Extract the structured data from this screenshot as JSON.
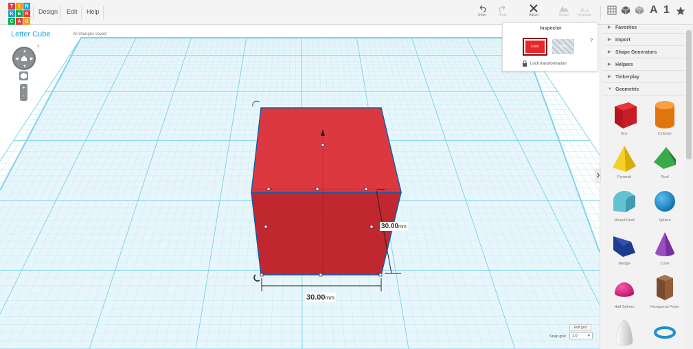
{
  "app": {
    "logo_letters": [
      "TIN",
      "KER",
      "CAD"
    ],
    "menu": [
      {
        "id": "design",
        "label": "Design"
      },
      {
        "id": "edit",
        "label": "Edit"
      },
      {
        "id": "help",
        "label": "Help"
      }
    ]
  },
  "toolbar": {
    "undo": "Undo",
    "redo": "Redo",
    "adjust": "Adjust",
    "group": "Group",
    "ungroup": "Ungroup",
    "view_text_label": "A",
    "view_number_label": "1"
  },
  "design": {
    "title": "Letter Cube",
    "status": "All changes saved"
  },
  "inspector": {
    "title": "Inspector",
    "color_label": "Color",
    "hole_label": "Hole",
    "help": "?",
    "lock_label": "Lock transformation",
    "selected_color": "#e8262b"
  },
  "navigation": {
    "help": "?",
    "zoom_in": "+",
    "zoom_out": "-"
  },
  "dimensions": {
    "width_value": "30.00",
    "depth_value": "30.00",
    "unit": "mm"
  },
  "sidebar": {
    "collapse_icon": "chevron-right-icon",
    "sections": [
      {
        "label": "Favorites",
        "expanded": false
      },
      {
        "label": "Import",
        "expanded": false
      },
      {
        "label": "Shape Generators",
        "expanded": false
      },
      {
        "label": "Helpers",
        "expanded": false
      },
      {
        "label": "Tinkerplay",
        "expanded": false
      },
      {
        "label": "Geometric",
        "expanded": true
      }
    ],
    "shapes": [
      {
        "name": "Box",
        "color": "#e02531"
      },
      {
        "name": "Cylinder",
        "color": "#f28c1c"
      },
      {
        "name": "Pyramid",
        "color": "#f2c811"
      },
      {
        "name": "Roof",
        "color": "#2f9e3f"
      },
      {
        "name": "Round Roof",
        "color": "#4fb8c9"
      },
      {
        "name": "Sphere",
        "color": "#1e90d0"
      },
      {
        "name": "Wedge",
        "color": "#1f3a8a"
      },
      {
        "name": "Cone",
        "color": "#8e3fb0"
      },
      {
        "name": "Half Sphere",
        "color": "#e0187c"
      },
      {
        "name": "Hexagonal Prism",
        "color": "#8a5a3a"
      },
      {
        "name": "",
        "color": "#e8e8e8"
      },
      {
        "name": "",
        "color": "#1e90d0"
      }
    ]
  },
  "snap": {
    "edit_grid_label": "Edit grid",
    "snap_label": "Snap grid",
    "snap_value": "1.0"
  },
  "colors": {
    "accent": "#1ea3db",
    "grid_major": "#7fd3ea",
    "grid_minor": "#c9ecf6",
    "cube_front": "#c1272e",
    "cube_top": "#dc3840"
  }
}
